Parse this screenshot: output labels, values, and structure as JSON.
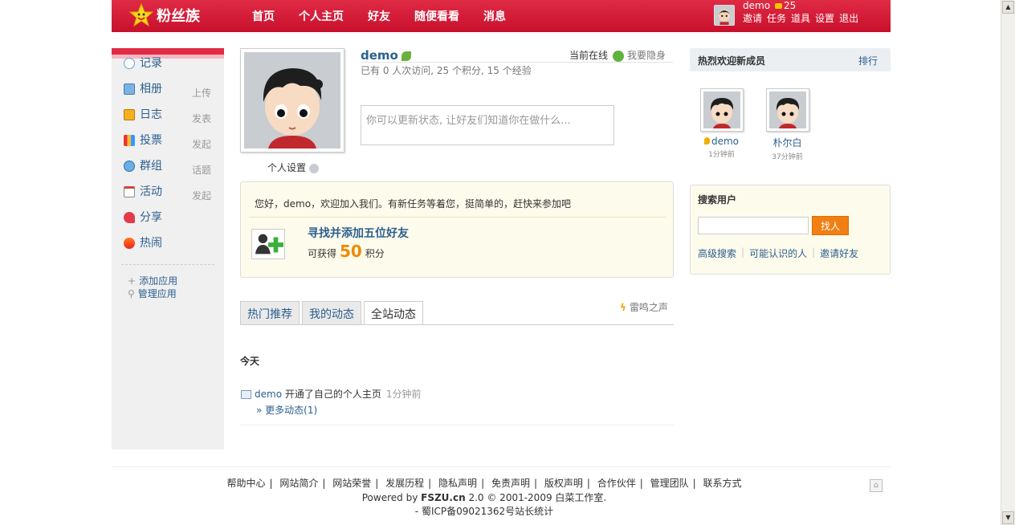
{
  "header": {
    "logo_text": "粉丝族",
    "nav": [
      "首页",
      "个人主页",
      "好友",
      "随便看看",
      "消息"
    ],
    "username": "demo",
    "credits": "25",
    "user_links": [
      "邀请",
      "任务",
      "道具",
      "设置",
      "退出"
    ]
  },
  "sidebar": {
    "items": [
      {
        "label": "记录",
        "action": "",
        "icon": "record-icon"
      },
      {
        "label": "相册",
        "action": "上传",
        "icon": "album-icon"
      },
      {
        "label": "日志",
        "action": "发表",
        "icon": "blog-icon"
      },
      {
        "label": "投票",
        "action": "发起",
        "icon": "poll-icon"
      },
      {
        "label": "群组",
        "action": "话题",
        "icon": "group-icon"
      },
      {
        "label": "活动",
        "action": "发起",
        "icon": "event-icon"
      },
      {
        "label": "分享",
        "action": "",
        "icon": "share-icon"
      },
      {
        "label": "热闹",
        "action": "",
        "icon": "hot-icon"
      }
    ],
    "add_app": "添加应用",
    "manage_app": "管理应用"
  },
  "profile": {
    "name": "demo",
    "online": "当前在线",
    "invisible": "我要隐身",
    "stats": "已有  0 人次访问, 25 个积分, 15 个经验",
    "status_placeholder": "你可以更新状态, 让好友们知道你在做什么...",
    "settings": "个人设置"
  },
  "welcome": {
    "text": "您好，demo，欢迎加入我们。有新任务等着您，挺简单的，赶快来参加吧",
    "task": "寻找并添加五位好友",
    "gain_prefix": "可获得",
    "gain_value": "50",
    "gain_suffix": "积分"
  },
  "tabs": [
    "热门推荐",
    "我的动态",
    "全站动态"
  ],
  "thunder": "雷鸣之声",
  "feed": {
    "heading": "今天",
    "user": "demo",
    "action": "开通了自己的个人主页",
    "time": "1分钟前",
    "more": "» 更多动态(1)"
  },
  "new_members": {
    "title": "热烈欢迎新成员",
    "rank": "排行",
    "members": [
      {
        "name": "demo",
        "time": "1分钟前"
      },
      {
        "name": "朴尔白",
        "time": "37分钟前"
      }
    ]
  },
  "search": {
    "title": "搜索用户",
    "button": "找人",
    "links": [
      "高级搜索",
      "可能认识的人",
      "邀请好友"
    ]
  },
  "footer": {
    "links": [
      "帮助中心",
      "网站简介",
      "网站荣誉",
      "发展历程",
      "隐私声明",
      "免责声明",
      "版权声明",
      "合作伙伴",
      "管理团队",
      "联系方式"
    ],
    "powered_prefix": "Powered by",
    "powered_site": "FSZU.cn",
    "powered_suffix": "2.0 © 2001-2009 白菜工作室.",
    "icp": "- 蜀ICP备09021362号站长统计"
  },
  "colors": {
    "brand": "#c8102d",
    "link": "#2c5f8f",
    "accent": "#f07f14"
  }
}
